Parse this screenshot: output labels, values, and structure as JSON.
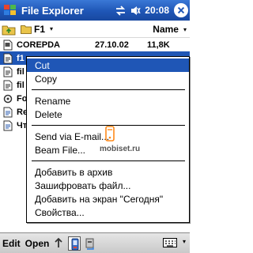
{
  "titlebar": {
    "title": "File Explorer",
    "clock": "20:08",
    "ok_label": "ok"
  },
  "toolbar": {
    "folder_label": "F1",
    "sort_label": "Name",
    "caret": "▾"
  },
  "files": [
    {
      "name": "COREPDA",
      "date": "27.10.02",
      "size": "11,8K",
      "icon": "document-icon"
    },
    {
      "name": "f1",
      "date": "",
      "size": "",
      "icon": "file-icon"
    },
    {
      "name": "fil",
      "date": "",
      "size": "",
      "icon": "file-icon"
    },
    {
      "name": "fil",
      "date": "",
      "size": "",
      "icon": "file-icon"
    },
    {
      "name": "Fo",
      "date": "",
      "size": "",
      "icon": "gear-file-icon"
    },
    {
      "name": "Re",
      "date": "",
      "size": "",
      "icon": "document-icon"
    },
    {
      "name": "Чт",
      "date": "",
      "size": "",
      "icon": "document-icon"
    }
  ],
  "context_menu": {
    "items": [
      {
        "label": "Cut"
      },
      {
        "label": "Copy"
      },
      {
        "label": "Rename"
      },
      {
        "label": "Delete"
      },
      {
        "label": "Send via E-mail..."
      },
      {
        "label": "Beam File..."
      },
      {
        "label": "Добавить в архив"
      },
      {
        "label": "Зашифровать файл..."
      },
      {
        "label": "Добавить на экран \"Сегодня\""
      },
      {
        "label": "Свойства..."
      }
    ],
    "watermark": "mobiset.ru"
  },
  "bottombar": {
    "edit_label": "Edit",
    "open_label": "Open",
    "caret": "▾"
  },
  "colors": {
    "titlebar": "#1f56b6",
    "selection": "#1f56b6",
    "background": "#ffffff"
  }
}
